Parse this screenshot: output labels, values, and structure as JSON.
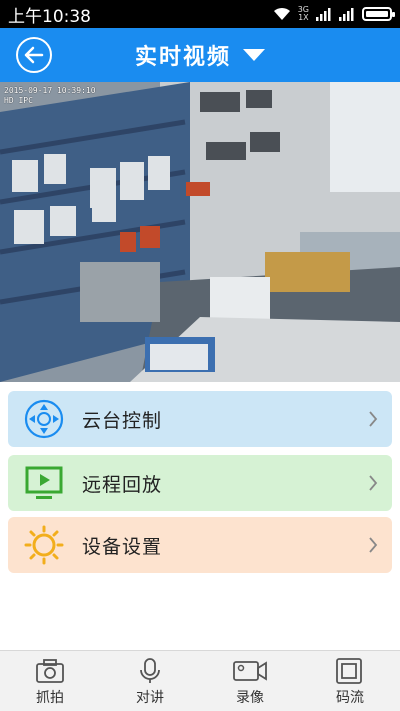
{
  "status_bar": {
    "time": "上午10:38",
    "net_top": "3G",
    "net_bottom": "1X"
  },
  "header": {
    "title": "实时视频"
  },
  "video": {
    "osd_line1": "2015-09-17 10:39:10",
    "osd_line2": "HD IPC"
  },
  "menu": [
    {
      "label": "云台控制",
      "icon": "ptz-control-icon",
      "color": "#cce6f6"
    },
    {
      "label": "远程回放",
      "icon": "monitor-play-icon",
      "color": "#d6f2d4"
    },
    {
      "label": "设备设置",
      "icon": "sun-gear-icon",
      "color": "#fde3cf"
    }
  ],
  "bottom_tabs": [
    {
      "label": "抓拍",
      "icon": "camera-icon"
    },
    {
      "label": "对讲",
      "icon": "microphone-icon"
    },
    {
      "label": "录像",
      "icon": "video-camera-icon"
    },
    {
      "label": "码流",
      "icon": "stream-icon"
    }
  ]
}
